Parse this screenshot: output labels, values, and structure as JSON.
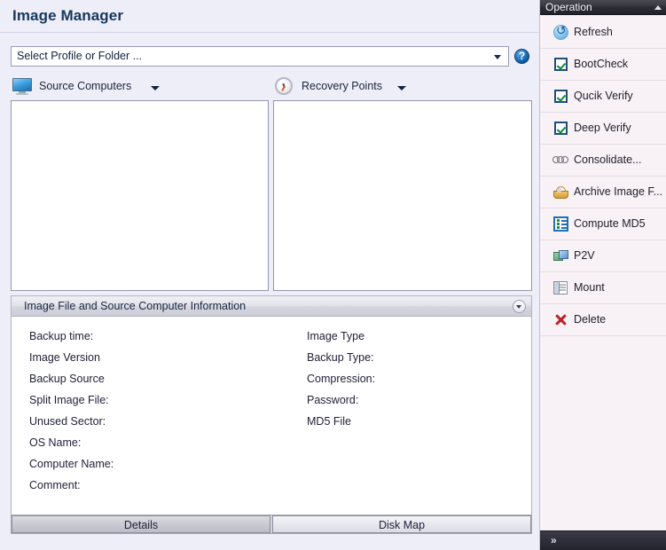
{
  "header": {
    "title": "Image Manager"
  },
  "profile": {
    "value": "Select Profile or Folder ...",
    "help_label": "?"
  },
  "columns": {
    "source": {
      "label": "Source Computers",
      "icon": "monitor-icon"
    },
    "recovery": {
      "label": "Recovery Points",
      "icon": "clock-icon"
    }
  },
  "info_section": {
    "title": "Image File and Source Computer Information",
    "left_fields": [
      "Backup time:",
      "Image Version",
      "Backup Source",
      "Split Image File:",
      "Unused Sector:",
      "OS Name:",
      "Computer Name:",
      "Comment:"
    ],
    "right_fields": [
      "Image Type",
      "Backup Type:",
      "Compression:",
      "Password:",
      "MD5 File"
    ]
  },
  "tabs": [
    {
      "label": "Details",
      "selected": true
    },
    {
      "label": "Disk Map",
      "selected": false
    }
  ],
  "sidebar": {
    "header": "Operation",
    "footer_icon": "»",
    "items": [
      {
        "label": "Refresh",
        "icon": "refresh-icon",
        "checkbox": false
      },
      {
        "label": "BootCheck",
        "icon": "checkbox-icon",
        "checkbox": true
      },
      {
        "label": "Qucik Verify",
        "icon": "checkbox-icon",
        "checkbox": true
      },
      {
        "label": "Deep Verify",
        "icon": "checkbox-icon",
        "checkbox": true
      },
      {
        "label": "Consolidate...",
        "icon": "chain-icon",
        "checkbox": false
      },
      {
        "label": "Archive Image F...",
        "icon": "basket-icon",
        "checkbox": false
      },
      {
        "label": "Compute MD5",
        "icon": "md5-list-icon",
        "checkbox": false
      },
      {
        "label": "P2V",
        "icon": "p2v-icon",
        "checkbox": false
      },
      {
        "label": "Mount",
        "icon": "mount-icon",
        "checkbox": false
      },
      {
        "label": "Delete",
        "icon": "delete-x-icon",
        "checkbox": false
      }
    ]
  },
  "colors": {
    "page_background": "#eeeef8",
    "title_text": "#17375e",
    "sidebar_background": "#f8f2f6",
    "sidebar_header": "#2b2b33",
    "accent_blue": "#1f4e79",
    "check_green": "#0f8a34",
    "delete_red": "#c0202a"
  }
}
